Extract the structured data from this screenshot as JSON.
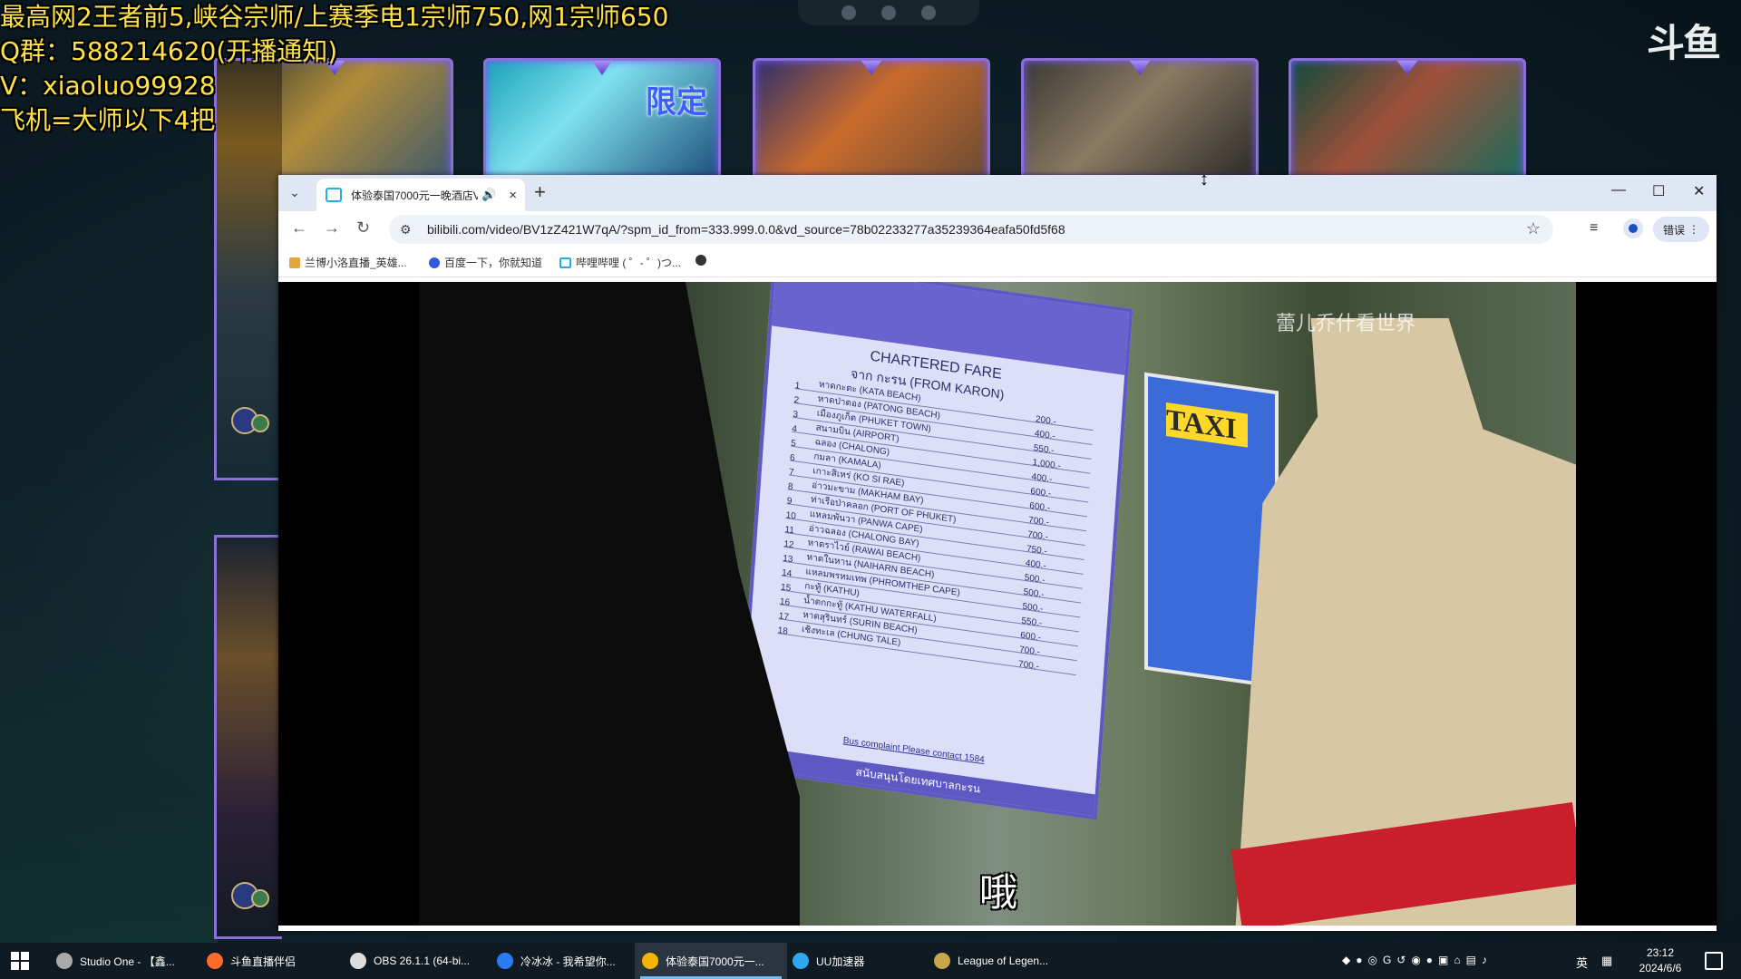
{
  "stream_overlay": {
    "lines": [
      "最高网2王者前5,峡谷宗师/上赛季电1宗师750,网1宗师650",
      "Q群：588214620(开播通知)",
      "V：xiaoluo99928",
      "飞机=大师以下4把"
    ],
    "logo": "斗鱼"
  },
  "game_bg": {
    "limited_tag": "限定"
  },
  "browser": {
    "tab": {
      "title": "体验泰国7000元一晚酒店V",
      "audio_icon": "speaker-icon",
      "close": "×"
    },
    "new_tab": "+",
    "window": {
      "minimize": "—",
      "maximize": "☐",
      "close": "✕"
    },
    "nav": {
      "back": "←",
      "forward": "→",
      "reload": "↻"
    },
    "url": "bilibili.com/video/BV1zZ421W7qA/?spm_id_from=333.999.0.0&vd_source=78b02233277a35239364eafa50fd5f68",
    "error_label": "错误",
    "bookmarks": [
      {
        "label": "兰博小洛直播_英雄...",
        "color": "#e2a73a"
      },
      {
        "label": "百度一下，你就知道",
        "color": "#2f5bdc"
      },
      {
        "label": "哔哩哔哩 ( ゜- ゜)つ...",
        "color": "#23ade5"
      },
      {
        "label": "",
        "color": "#333333"
      }
    ]
  },
  "video": {
    "watermark": "蕾儿乔什看世界",
    "subtitle": "哦",
    "taxi_text": "TAXI",
    "sign": {
      "title": "CHARTERED FARE",
      "from": "จาก กะรน (FROM KARON)",
      "rows": [
        {
          "no": "1",
          "dest": "หาดกะตะ (KATA BEACH)",
          "fare": "200.-"
        },
        {
          "no": "2",
          "dest": "หาดป่าตอง (PATONG BEACH)",
          "fare": "400.-"
        },
        {
          "no": "3",
          "dest": "เมืองภูเก็ต (PHUKET TOWN)",
          "fare": "550.-"
        },
        {
          "no": "4",
          "dest": "สนามบิน (AIRPORT)",
          "fare": "1,000.-"
        },
        {
          "no": "5",
          "dest": "ฉลอง (CHALONG)",
          "fare": "400.-"
        },
        {
          "no": "6",
          "dest": "กมลา (KAMALA)",
          "fare": "600.-"
        },
        {
          "no": "7",
          "dest": "เกาะสิเหร่ (KO SI RAE)",
          "fare": "600.-"
        },
        {
          "no": "8",
          "dest": "อ่าวมะขาม (MAKHAM BAY)",
          "fare": "700.-"
        },
        {
          "no": "9",
          "dest": "ท่าเรือป่าคลอก (PORT OF PHUKET)",
          "fare": "700.-"
        },
        {
          "no": "10",
          "dest": "แหลมพันวา (PANWA CAPE)",
          "fare": "750.-"
        },
        {
          "no": "11",
          "dest": "อ่าวฉลอง (CHALONG BAY)",
          "fare": "400.-"
        },
        {
          "no": "12",
          "dest": "หาดราไวย์ (RAWAI BEACH)",
          "fare": "500.-"
        },
        {
          "no": "13",
          "dest": "หาดในหาน (NAIHARN BEACH)",
          "fare": "500.-"
        },
        {
          "no": "14",
          "dest": "แหลมพรหมเทพ (PHROMTHEP CAPE)",
          "fare": "500.-"
        },
        {
          "no": "15",
          "dest": "กะทู้ (KATHU)",
          "fare": "550.-"
        },
        {
          "no": "16",
          "dest": "น้ำตกกะทู้ (KATHU WATERFALL)",
          "fare": "600.-"
        },
        {
          "no": "17",
          "dest": "หาดสุรินทร์ (SURIN BEACH)",
          "fare": "700.-"
        },
        {
          "no": "18",
          "dest": "เชิงทะเล (CHUNG TALE)",
          "fare": "700.-"
        }
      ],
      "complaint": "Bus complaint Please contact 1584",
      "footer": "สนับสนุนโดยเทศบาลกะรน"
    }
  },
  "taskbar": {
    "tasks": [
      {
        "label": "Studio One - 【鑫...",
        "color": "#aaaaaa"
      },
      {
        "label": "斗鱼直播伴侣",
        "color": "#ff6b2e"
      },
      {
        "label": "OBS 26.1.1 (64-bi...",
        "color": "#dddddd"
      },
      {
        "label": "冷冰冰 - 我希望你...",
        "color": "#2b7bf2"
      },
      {
        "label": "体验泰国7000元一...",
        "color": "#f4b400",
        "active": true
      },
      {
        "label": "UU加速器",
        "color": "#2fa7f0"
      },
      {
        "label": "League of Legen...",
        "color": "#c8a44a"
      }
    ],
    "tray_lang": "英",
    "clock_time": "23:12",
    "clock_date": "2024/6/6"
  }
}
